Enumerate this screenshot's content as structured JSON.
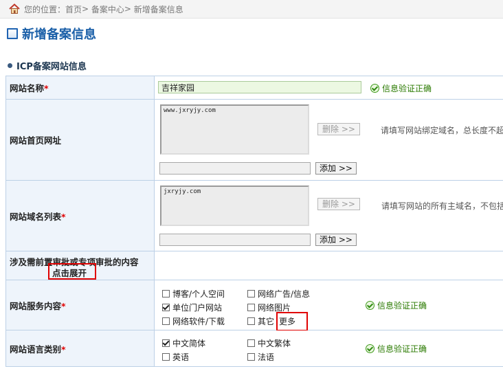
{
  "breadcrumb": {
    "prefix": "您的位置：",
    "items": [
      "首页",
      "备案中心",
      "新增备案信息"
    ],
    "sep": "> "
  },
  "page_title": "新增备案信息",
  "section_title": "ICP备案网站信息",
  "fields": {
    "site_name": {
      "label": "网站名称",
      "value": "吉祥家园",
      "status": "信息验证正确"
    },
    "home_url": {
      "label": "网站首页网址",
      "list_value": "www.jxryjy.com",
      "delete_label": "删除 >>",
      "add_label": "添加 >>",
      "hint": "请填写网站绑定域名，总长度不超过"
    },
    "domain_list": {
      "label": "网站域名列表",
      "list_value": "jxryjy.com",
      "delete_label": "删除 >>",
      "add_label": "添加 >>",
      "hint": "请填写网站的所有主域名，不包括二"
    },
    "approval": {
      "label": "涉及需前置审批或专项审批的内容",
      "expand_label": "点击展开"
    },
    "service": {
      "label": "网站服务内容",
      "options": [
        {
          "label": "博客/个人空间",
          "checked": false
        },
        {
          "label": "网络广告/信息",
          "checked": false
        },
        {
          "label": "单位门户网站",
          "checked": true
        },
        {
          "label": "网络图片",
          "checked": false
        },
        {
          "label": "网络软件/下载",
          "checked": false
        },
        {
          "label": "其它",
          "checked": false
        }
      ],
      "more_label": "更多",
      "status": "信息验证正确"
    },
    "language": {
      "label": "网站语言类别",
      "options": [
        {
          "label": "中文简体",
          "checked": true
        },
        {
          "label": "中文繁体",
          "checked": false
        },
        {
          "label": "英语",
          "checked": false
        },
        {
          "label": "法语",
          "checked": false
        }
      ],
      "status": "信息验证正确"
    }
  },
  "colors": {
    "required": "#e00000",
    "title": "#1a5fa8",
    "success": "#2a7a00",
    "highlight": "#e00000"
  },
  "icons": [
    "home-icon",
    "title-box-icon",
    "section-dot-icon",
    "check-circle-icon",
    "checkbox-icon"
  ]
}
